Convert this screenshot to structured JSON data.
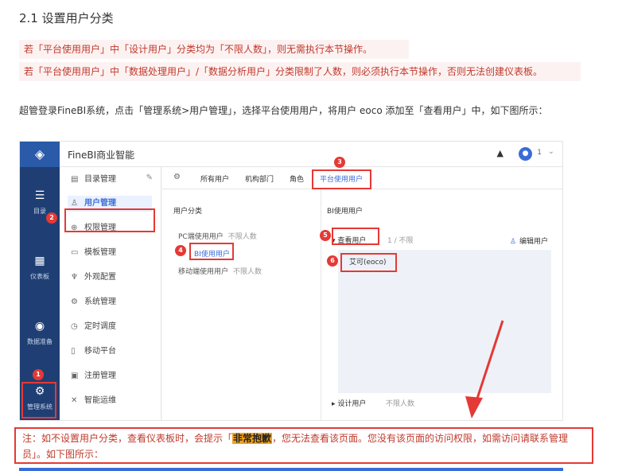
{
  "doc": {
    "section_title": "2.1 设置用户分类",
    "tip1": "若「平台使用用户」中「设计用户」分类均为「不限人数」，则无需执行本节操作。",
    "tip2": "若「平台使用用户」中「数据处理用户」/「数据分析用户」分类限制了人数，则必须执行本节操作，否则无法创建仪表板。",
    "instruction": "超管登录FineBI系统，点击「管理系统>用户管理」，选择平台使用用户，将用户 eoco 添加至「查看用户」中，如下图所示："
  },
  "screenshot": {
    "app_title": "FineBI商业智能",
    "user_count": "1",
    "rail": [
      {
        "label": "目录",
        "icon": "grid-icon"
      },
      {
        "label": "仪表板",
        "icon": "dashboard-icon"
      },
      {
        "label": "数据准备",
        "icon": "database-icon"
      },
      {
        "label": "管理系统",
        "icon": "gear-icon"
      }
    ],
    "side_items": [
      {
        "label": "目录管理",
        "icon": "folder-icon"
      },
      {
        "label": "用户管理",
        "icon": "user-icon"
      },
      {
        "label": "权限管理",
        "icon": "lock-icon"
      },
      {
        "label": "模板管理",
        "icon": "template-icon"
      },
      {
        "label": "外观配置",
        "icon": "brush-icon"
      },
      {
        "label": "系统管理",
        "icon": "settings-icon"
      },
      {
        "label": "定时调度",
        "icon": "clock-icon"
      },
      {
        "label": "移动平台",
        "icon": "mobile-icon"
      },
      {
        "label": "注册管理",
        "icon": "register-icon"
      },
      {
        "label": "智能运维",
        "icon": "ops-icon"
      }
    ],
    "tabs": [
      "所有用户",
      "机构部门",
      "角色",
      "平台使用用户"
    ],
    "left_panel_title": "用户分类",
    "categories": [
      {
        "label": "PC端使用用户",
        "limit": "不限人数"
      },
      {
        "label": "BI使用用户",
        "limit": ""
      },
      {
        "label": "移动端使用用户",
        "limit": "不限人数"
      }
    ],
    "right_panel_title": "BI使用用户",
    "view_group": "查看用户",
    "view_count": "1 / 不限",
    "edit_users": "编辑用户",
    "user_entry": "艾可(eoco)",
    "design_group": "设计用户",
    "design_limit": "不限人数",
    "badges": [
      "1",
      "2",
      "3",
      "4",
      "5",
      "6"
    ],
    "accent_color": "#3a6cd8",
    "highlight_color": "#e53935"
  },
  "note": {
    "prefix": "注：如不设置用户分类，查看仪表板时，会提示「",
    "highlight": "非常抱歉",
    "suffix": "，您无法查看该页面。您没有该页面的访问权限，如需访问请联系管理员」。如下图所示："
  }
}
